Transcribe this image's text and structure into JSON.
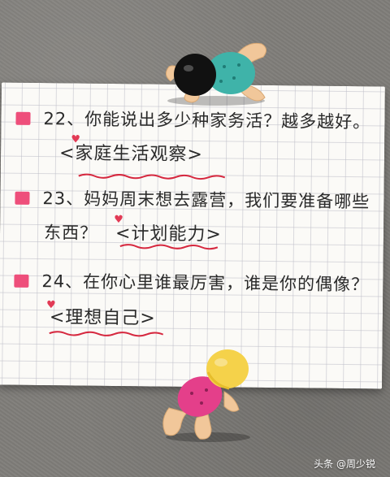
{
  "notes": {
    "item22": {
      "question": "22、你能说出多少种家务活？越多越好。",
      "tag": "<家庭生活观察>"
    },
    "item23": {
      "question_line1": "23、妈妈周末想去露营，我们要准备哪些",
      "question_line2": "东西？",
      "tag": "<计划能力>"
    },
    "item24": {
      "question": "24、在你心里谁最厉害，谁是你的偶像？",
      "tag": "<理想自己>"
    }
  },
  "watermark": "头条 @周少锐",
  "colors": {
    "bullet": "#ee4f7b",
    "heart": "#e23a55",
    "underline": "#d6283f"
  },
  "icons": {
    "bullet": "pink-square-bullet",
    "heart": "heart-icon"
  }
}
